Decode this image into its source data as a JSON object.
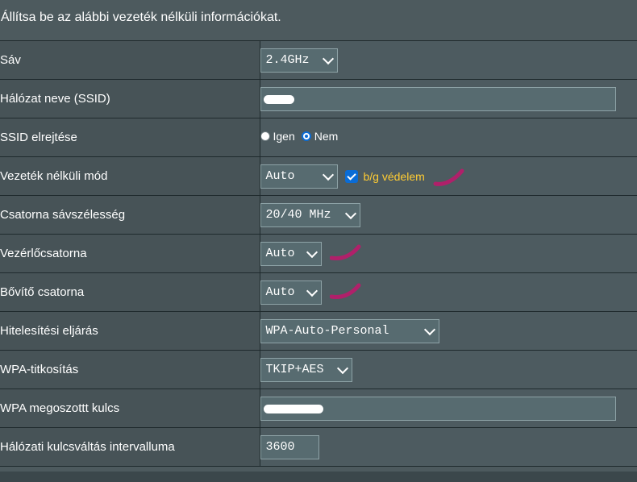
{
  "header": {
    "instruction": "Állítsa be az alábbi vezeték nélküli információkat."
  },
  "rows": {
    "band": {
      "label": "Sáv",
      "value": "2.4GHz"
    },
    "ssid": {
      "label": "Hálózat neve (SSID)",
      "value": ""
    },
    "hide_ssid": {
      "label": "SSID elrejtése",
      "option_yes": "Igen",
      "option_no": "Nem",
      "selected": "Nem"
    },
    "wireless_mode": {
      "label": "Vezeték nélküli mód",
      "value": "Auto",
      "checkbox_label": "b/g védelem",
      "checkbox_checked": true
    },
    "channel_bandwidth": {
      "label": "Csatorna sávszélesség",
      "value": "20/40 MHz"
    },
    "control_channel": {
      "label": "Vezérlőcsatorna",
      "value": "Auto"
    },
    "extension_channel": {
      "label": "Bővítő csatorna",
      "value": "Auto"
    },
    "auth_method": {
      "label": "Hitelesítési eljárás",
      "value": "WPA-Auto-Personal"
    },
    "wpa_encryption": {
      "label": "WPA-titkosítás",
      "value": "TKIP+AES"
    },
    "wpa_key": {
      "label": "WPA megoszottt kulcs",
      "value": ""
    },
    "key_rotation": {
      "label": "Hálózati kulcsváltás intervalluma",
      "value": "3600"
    }
  },
  "colors": {
    "accent": "#0a6cd6",
    "highlight_label": "#ffcc33",
    "annotation_mark": "#b0206a"
  },
  "icons": {
    "dropdown": "chevron-down-icon",
    "annotation": "pen-mark-icon"
  }
}
